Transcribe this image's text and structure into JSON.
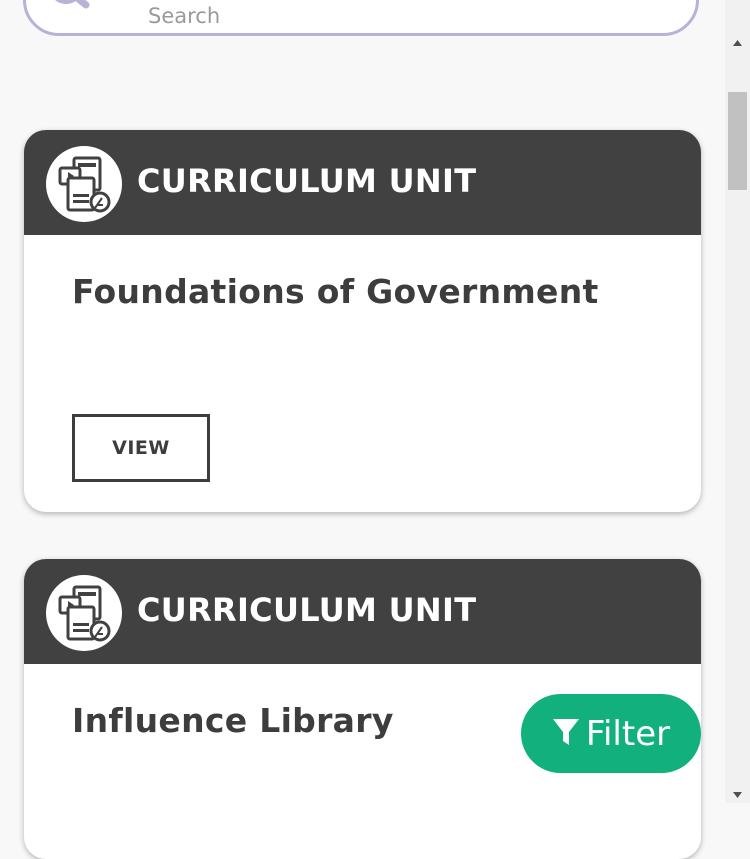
{
  "search": {
    "placeholder": "Search",
    "icon": "search-icon"
  },
  "cards": [
    {
      "type_label": "CURRICULUM UNIT",
      "title": "Foundations of Government",
      "button_label": "VIEW",
      "icon": "curriculum-unit-icon"
    },
    {
      "type_label": "CURRICULUM UNIT",
      "title": "Influence Library",
      "icon": "curriculum-unit-icon"
    }
  ],
  "filter": {
    "label": "Filter",
    "icon": "funnel-icon",
    "color": "#12b07c"
  },
  "colors": {
    "header": "#414141",
    "search_border": "#b9b1d8"
  }
}
